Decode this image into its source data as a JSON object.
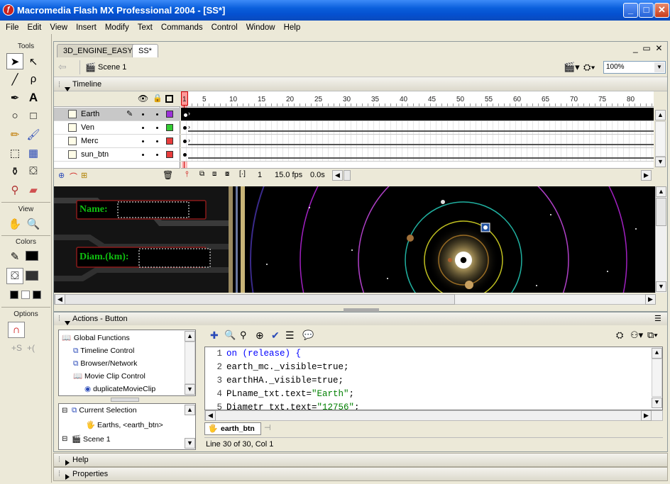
{
  "window": {
    "title": "Macromedia Flash MX Professional 2004 - [SS*]",
    "app_icon": "flash-icon"
  },
  "menu": [
    "File",
    "Edit",
    "View",
    "Insert",
    "Modify",
    "Text",
    "Commands",
    "Control",
    "Window",
    "Help"
  ],
  "tools": {
    "title": "Tools",
    "view_label": "View",
    "colors_label": "Colors",
    "options_label": "Options"
  },
  "doc_tabs": [
    {
      "label": "3D_ENGINE_EASY*"
    },
    {
      "label": "SS*",
      "active": true
    }
  ],
  "scene": {
    "label": "Scene 1",
    "zoom": "100%"
  },
  "timeline": {
    "title": "Timeline",
    "ruler": [
      "1",
      "5",
      "10",
      "15",
      "20",
      "25",
      "30",
      "35",
      "40",
      "45",
      "50",
      "55",
      "60",
      "65",
      "70",
      "75",
      "80"
    ],
    "layers": [
      {
        "name": "Earth",
        "selected": true,
        "color": "#9b30d8"
      },
      {
        "name": "Ven",
        "color": "#33cc33"
      },
      {
        "name": "Merc",
        "color": "#e83c3c"
      },
      {
        "name": "sun_btn",
        "color": "#e83c3c"
      }
    ],
    "current_frame": "1",
    "fps": "15.0 fps",
    "time": "0.0s"
  },
  "stage": {
    "name_label": "Name:",
    "diam_label": "Diam.(km):"
  },
  "actions": {
    "title": "Actions - Button",
    "functions": [
      {
        "label": "Global Functions"
      },
      {
        "label": "Timeline Control"
      },
      {
        "label": "Browser/Network"
      },
      {
        "label": "Movie Clip Control"
      },
      {
        "label": "duplicateMovieClip"
      }
    ],
    "tree": [
      {
        "label": "Current Selection"
      },
      {
        "label": "Earths, <earth_btn>"
      },
      {
        "label": "Scene 1"
      }
    ],
    "code": [
      {
        "n": "1",
        "text": "on (release) {"
      },
      {
        "n": "2",
        "text": "earth_mc._visible=true;"
      },
      {
        "n": "3",
        "text": "earthHA._visible=true;"
      },
      {
        "n": "4",
        "text": "PLname_txt.text=\"Earth\";"
      },
      {
        "n": "5",
        "text": "Diametr_txt.text=\"12756\";"
      }
    ],
    "script_tab": "earth_btn",
    "status": "Line 30 of 30, Col 1"
  },
  "panels": {
    "help": "Help",
    "properties": "Properties"
  }
}
